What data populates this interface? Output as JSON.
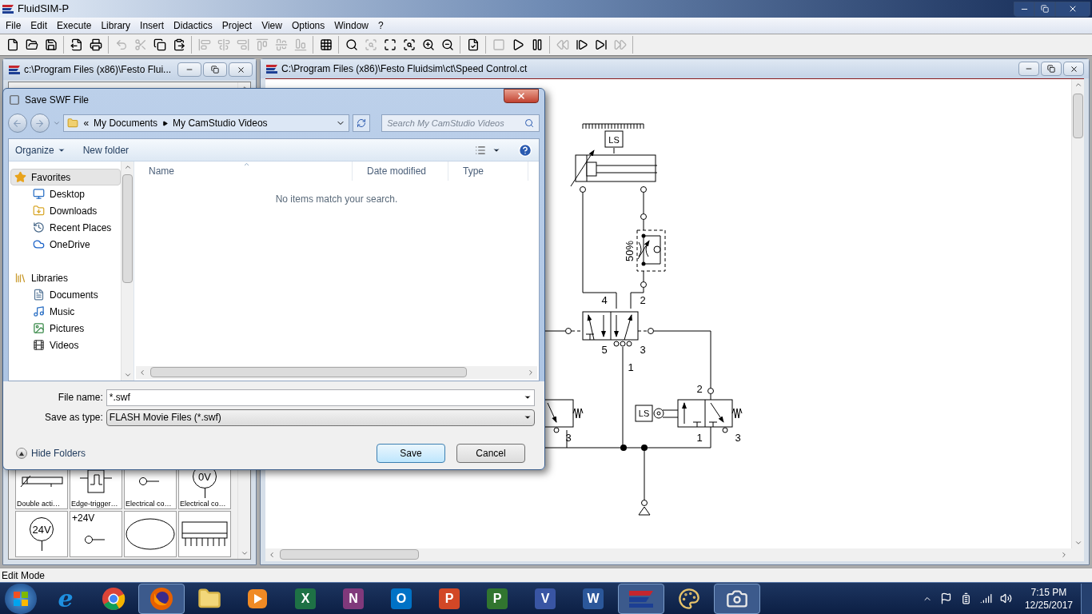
{
  "app": {
    "title": "FluidSIM-P",
    "menu": [
      "File",
      "Edit",
      "Execute",
      "Library",
      "Insert",
      "Didactics",
      "Project",
      "View",
      "Options",
      "Window",
      "?"
    ]
  },
  "toolbar": [
    {
      "kind": "new",
      "disabled": false
    },
    {
      "kind": "open",
      "disabled": false
    },
    {
      "kind": "save",
      "disabled": false
    },
    {
      "kind": "sep"
    },
    {
      "kind": "export",
      "disabled": false
    },
    {
      "kind": "print",
      "disabled": false
    },
    {
      "kind": "sep"
    },
    {
      "kind": "undo",
      "disabled": true
    },
    {
      "kind": "cut",
      "disabled": true
    },
    {
      "kind": "copy",
      "disabled": false
    },
    {
      "kind": "paste",
      "disabled": false
    },
    {
      "kind": "sep"
    },
    {
      "kind": "align-left",
      "disabled": true
    },
    {
      "kind": "align-center",
      "disabled": true
    },
    {
      "kind": "align-right",
      "disabled": true
    },
    {
      "kind": "align-top",
      "disabled": true
    },
    {
      "kind": "align-middle",
      "disabled": true
    },
    {
      "kind": "align-bottom",
      "disabled": true
    },
    {
      "kind": "sep"
    },
    {
      "kind": "grid",
      "disabled": false
    },
    {
      "kind": "sep"
    },
    {
      "kind": "zoom-actual",
      "disabled": false
    },
    {
      "kind": "zoom-width",
      "disabled": true
    },
    {
      "kind": "zoom-all",
      "disabled": false
    },
    {
      "kind": "zoom-window",
      "disabled": false
    },
    {
      "kind": "zoom-in",
      "disabled": false
    },
    {
      "kind": "zoom-out",
      "disabled": false
    },
    {
      "kind": "sep"
    },
    {
      "kind": "check",
      "disabled": false
    },
    {
      "kind": "sep"
    },
    {
      "kind": "stop",
      "disabled": true
    },
    {
      "kind": "play",
      "disabled": false
    },
    {
      "kind": "pause",
      "disabled": false
    },
    {
      "kind": "sep"
    },
    {
      "kind": "rewind",
      "disabled": true
    },
    {
      "kind": "step",
      "disabled": false
    },
    {
      "kind": "step-end",
      "disabled": false
    },
    {
      "kind": "forward",
      "disabled": true
    },
    {
      "kind": "sep"
    }
  ],
  "library_window": {
    "title": "c:\\Program Files (x86)\\Festo Flui...",
    "tiles": [
      {
        "kind": "cylinder",
        "label": "Double acti…"
      },
      {
        "kind": "edge",
        "label": "Edge-trigger…"
      },
      {
        "kind": "terminal",
        "label": "Electrical co…"
      },
      {
        "kind": "circle-terminal",
        "symbol": "0V",
        "label": "Electrical co…"
      },
      {
        "kind": "circle-terminal",
        "symbol": "24V"
      },
      {
        "kind": "terminal",
        "symbol": "+24V"
      },
      {
        "kind": "ellipse"
      },
      {
        "kind": "chip"
      }
    ]
  },
  "circuit_window": {
    "title": "C:\\Program Files (x86)\\Festo Fluidsim\\ct\\Speed Control.ct",
    "diagram": {
      "cylinder_sensor": "LS",
      "flow_setting": "50%",
      "valve_ports": [
        "4",
        "2",
        "5",
        "3",
        "1"
      ],
      "roller_sensor": "LS",
      "roller_ports": [
        "2",
        "1",
        "3"
      ],
      "left_valve_port": "3"
    }
  },
  "dialog": {
    "title": "Save SWF File",
    "breadcrumb_overflow": "«",
    "breadcrumb": [
      "My Documents",
      "My CamStudio Videos"
    ],
    "search": {
      "placeholder": "Search My CamStudio Videos"
    },
    "commands": [
      "Organize",
      "New folder"
    ],
    "nav_groups": [
      {
        "label": "Favorites",
        "kind": "favorites",
        "selected": true,
        "items": [
          {
            "label": "Desktop",
            "kind": "desktop",
            "selected": false
          },
          {
            "label": "Downloads",
            "kind": "downloads",
            "selected": false
          },
          {
            "label": "Recent Places",
            "kind": "recent",
            "selected": false
          },
          {
            "label": "OneDrive",
            "kind": "cloud",
            "selected": false
          }
        ]
      },
      {
        "label": "Libraries",
        "kind": "libraries",
        "selected": false,
        "items": [
          {
            "label": "Documents",
            "kind": "documents",
            "selected": false
          },
          {
            "label": "Music",
            "kind": "music",
            "selected": false
          },
          {
            "label": "Pictures",
            "kind": "pictures",
            "selected": false
          },
          {
            "label": "Videos",
            "kind": "videos",
            "selected": false
          }
        ]
      }
    ],
    "columns": [
      {
        "label": "Name",
        "sorted": true
      },
      {
        "label": "Date modified",
        "sorted": false
      },
      {
        "label": "Type",
        "sorted": false
      }
    ],
    "empty_message": "No items match your search.",
    "file_name": {
      "label": "File name:",
      "value": "*.swf"
    },
    "save_type": {
      "label": "Save as type:",
      "value": "FLASH Movie Files (*.swf)"
    },
    "hide_folders": "Hide Folders",
    "buttons": [
      "Save",
      "Cancel"
    ]
  },
  "status_bar": "Edit Mode",
  "taskbar": {
    "apps": [
      {
        "kind": "ie",
        "glyph": "e",
        "open": false
      },
      {
        "kind": "chrome",
        "open": false
      },
      {
        "kind": "firefox",
        "open": true
      },
      {
        "kind": "explorer",
        "open": false
      },
      {
        "kind": "media",
        "open": false
      },
      {
        "kind": "office",
        "glyph": "X",
        "color": "#1e7145",
        "open": false
      },
      {
        "kind": "office",
        "glyph": "N",
        "color": "#80397b",
        "open": false
      },
      {
        "kind": "office",
        "glyph": "O",
        "color": "#0072c6",
        "open": false
      },
      {
        "kind": "office",
        "glyph": "P",
        "color": "#d24726",
        "open": false
      },
      {
        "kind": "office",
        "glyph": "P",
        "color": "#31752f",
        "open": false
      },
      {
        "kind": "office",
        "glyph": "V",
        "color": "#3955a3",
        "open": false
      },
      {
        "kind": "office",
        "glyph": "W",
        "color": "#2b579a",
        "open": false
      },
      {
        "kind": "festo",
        "open": true
      },
      {
        "kind": "paint",
        "open": false
      },
      {
        "kind": "camera",
        "open": true
      }
    ],
    "time": "7:15 PM",
    "date": "12/25/2017"
  }
}
